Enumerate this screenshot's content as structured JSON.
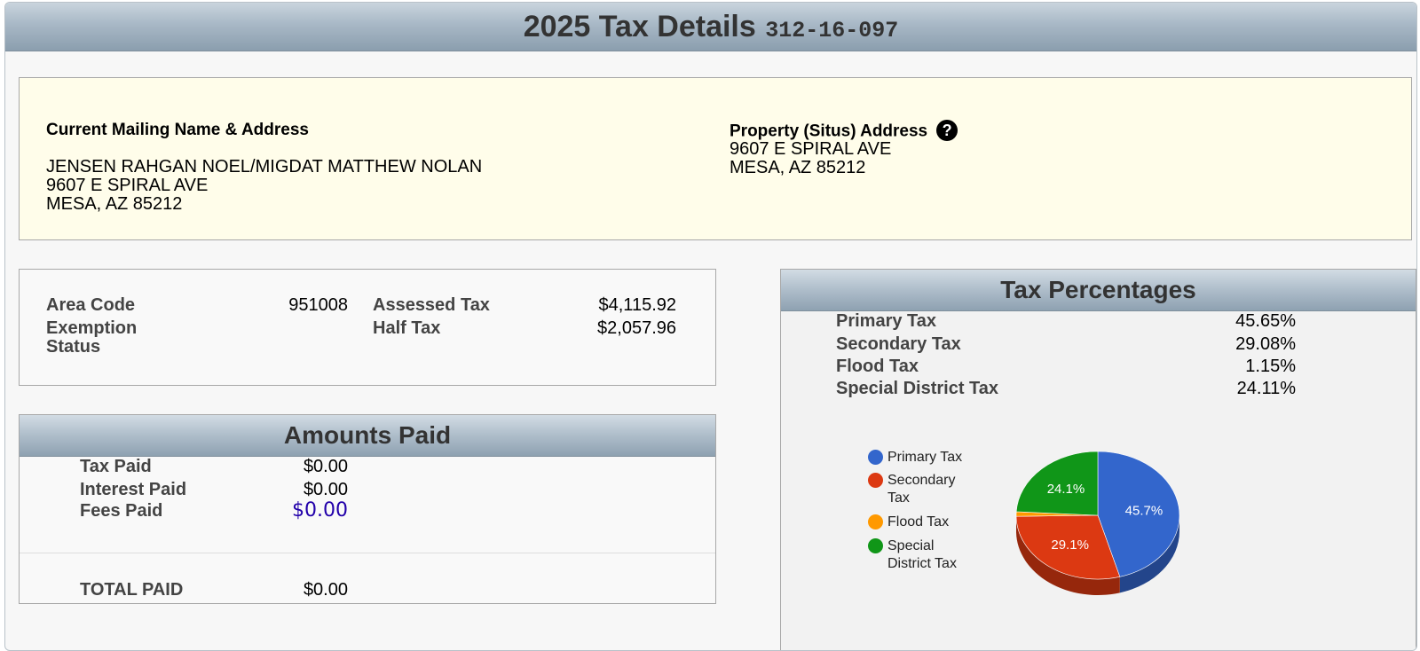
{
  "header": {
    "title": "2025 Tax Details",
    "parcel": "312-16-097"
  },
  "mailing": {
    "title": "Current Mailing Name & Address",
    "name": "JENSEN RAHGAN NOEL/MIGDAT MATTHEW NOLAN",
    "street": "9607 E SPIRAL AVE",
    "city": "MESA, AZ 85212"
  },
  "property": {
    "title": "Property (Situs) Address",
    "help_icon": "question-mark",
    "street": "9607 E SPIRAL AVE",
    "city": "MESA, AZ 85212"
  },
  "info": {
    "area_code_label": "Area Code",
    "area_code_value": "951008",
    "exemption_label_1": "Exemption",
    "exemption_label_2": "Status",
    "assessed_tax_label": "Assessed Tax",
    "assessed_tax_value": "$4,115.92",
    "half_tax_label": "Half Tax",
    "half_tax_value": "$2,057.96"
  },
  "paid": {
    "title": "Amounts Paid",
    "tax_paid_label": "Tax Paid",
    "tax_paid_value": "$0.00",
    "interest_paid_label": "Interest Paid",
    "interest_paid_value": "$0.00",
    "fees_paid_label": "Fees Paid",
    "fees_paid_value": "$0.00",
    "total_label": "TOTAL PAID",
    "total_value": "$0.00"
  },
  "percentages": {
    "title": "Tax Percentages",
    "rows": [
      {
        "label": "Primary Tax",
        "value": "45.65%"
      },
      {
        "label": "Secondary Tax",
        "value": "29.08%"
      },
      {
        "label": "Flood Tax",
        "value": "1.15%"
      },
      {
        "label": "Special District Tax",
        "value": "24.11%"
      }
    ]
  },
  "chart_data": {
    "type": "pie",
    "slices": [
      {
        "name": "Primary Tax",
        "value": 45.65,
        "label": "45.7%",
        "color": "#3366cc"
      },
      {
        "name": "Secondary Tax",
        "value": 29.08,
        "label": "29.1%",
        "color": "#dc3912"
      },
      {
        "name": "Flood Tax",
        "value": 1.15,
        "label": "",
        "color": "#ff9900"
      },
      {
        "name": "Special District Tax",
        "value": 24.11,
        "label": "24.1%",
        "color": "#109618"
      }
    ],
    "legend": {
      "placement": "left",
      "items": [
        {
          "name": "Primary Tax",
          "line1": "Primary Tax",
          "line2": "",
          "color": "#3366cc"
        },
        {
          "name": "Secondary Tax",
          "line1": "Secondary",
          "line2": "Tax",
          "color": "#dc3912"
        },
        {
          "name": "Flood Tax",
          "line1": "Flood Tax",
          "line2": "",
          "color": "#ff9900"
        },
        {
          "name": "Special District Tax",
          "line1": "Special",
          "line2": "District Tax",
          "color": "#109618"
        }
      ]
    },
    "is_3d": true
  }
}
